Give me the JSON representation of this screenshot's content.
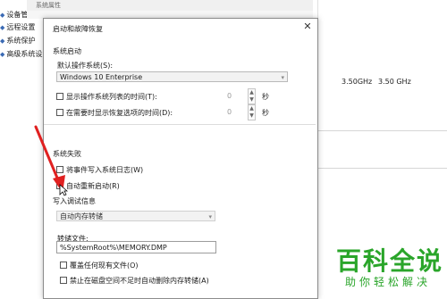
{
  "background_window": {
    "title": "系统属性",
    "sidebar": [
      {
        "label": "设备管理器"
      },
      {
        "label": "远程设置"
      },
      {
        "label": "系统保护"
      },
      {
        "label": "高级系统设置"
      }
    ],
    "cpu_speeds": [
      "3.50GHz",
      "3.50 GHz"
    ]
  },
  "dialog": {
    "title": "启动和故障恢复",
    "close_glyph": "✕",
    "startup_group": "系统启动",
    "default_os_label": "默认操作系统(S):",
    "default_os_value": "Windows 10 Enterprise",
    "show_os_list": {
      "label": "显示操作系统列表的时间(T):",
      "checked": false,
      "value": "0",
      "unit": "秒"
    },
    "show_recovery": {
      "label": "在需要时显示恢复选项的时间(D):",
      "checked": false,
      "value": "0",
      "unit": "秒"
    },
    "failure_group": "系统失败",
    "write_event_log": {
      "label": "将事件写入系统日志(W)",
      "checked": false
    },
    "auto_restart": {
      "label": "自动重新启动(R)",
      "checked": false
    },
    "debug_info_label": "写入调试信息",
    "debug_info_value": "自动内存转储",
    "dump_file_label": "转储文件:",
    "dump_file_value": "%SystemRoot%\\MEMORY.DMP",
    "overwrite": {
      "label": "覆盖任何现有文件(O)",
      "checked": false
    },
    "disable_auto_delete": {
      "label": "禁止在磁盘空间不足时自动删除内存转储(A)",
      "checked": false
    }
  },
  "watermark": {
    "title": "百科全说",
    "subtitle": "助你轻松解决",
    "color": "#2aa52a"
  },
  "annotation_arrow_color": "#e02020"
}
